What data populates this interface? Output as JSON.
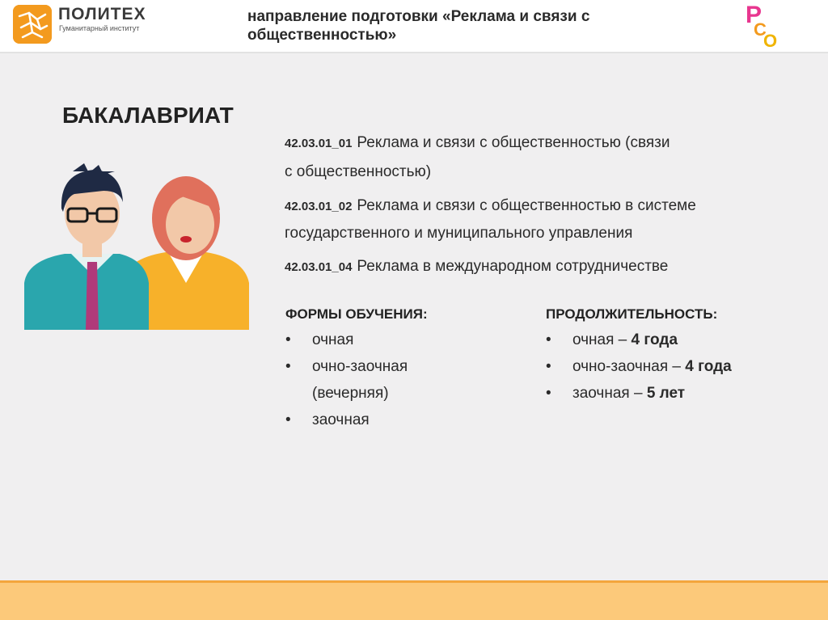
{
  "header": {
    "logo_name": "ПОЛИТЕХ",
    "logo_sub": "Гуманитарный институт",
    "title": "направление подготовки «Реклама и связи с общественностью»",
    "rso_logo_letters": "РСО"
  },
  "level_title": "БАКАЛАВРИАТ",
  "programs": [
    {
      "code": "42.03.01_01",
      "name": "Реклама и связи с общественностью (связи",
      "name_cont": "с общественностью)"
    },
    {
      "code": "42.03.01_02",
      "name": "Реклама и связи с общественностью в системе",
      "name_cont": "государственного и муниципального управления"
    },
    {
      "code": "42.03.01_04",
      "name": "Реклама в международном сотрудничестве"
    }
  ],
  "forms": {
    "heading": "ФОРМЫ ОБУЧЕНИЯ:",
    "items": [
      "очная",
      "очно-заочная",
      "(вечерняя)",
      "заочная"
    ]
  },
  "duration": {
    "heading": "ПРОДОЛЖИТЕЛЬНОСТЬ:",
    "items": [
      {
        "label": "очная",
        "sep": " – ",
        "value": "4 года"
      },
      {
        "label": "очно-заочная",
        "sep": " – ",
        "value": "4 года"
      },
      {
        "label": "заочная",
        "sep": " – ",
        "value": "5 лет"
      }
    ]
  },
  "colors": {
    "logo_orange": "#f39a1e",
    "footer": "#fcc97a",
    "footer_line": "#f3a53c",
    "man_shirt": "#2aa6ad",
    "woman_top": "#f7b12a",
    "woman_hair": "#e0705c",
    "tie": "#b03a7a"
  }
}
